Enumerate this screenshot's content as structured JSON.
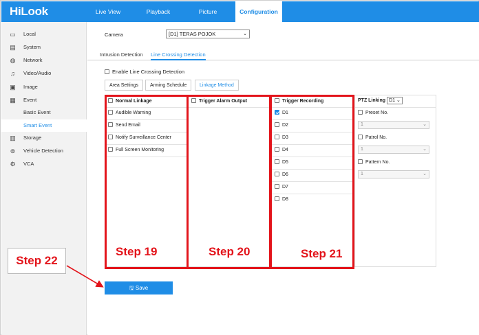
{
  "brand": {
    "logo": "HiLook"
  },
  "topnav": [
    {
      "label": "Live View"
    },
    {
      "label": "Playback"
    },
    {
      "label": "Picture"
    },
    {
      "label": "Configuration",
      "active": true
    }
  ],
  "sidebar": {
    "items": [
      {
        "label": "Local",
        "icon": "monitor-icon"
      },
      {
        "label": "System",
        "icon": "system-icon"
      },
      {
        "label": "Network",
        "icon": "globe-icon"
      },
      {
        "label": "Video/Audio",
        "icon": "video-audio-icon"
      },
      {
        "label": "Image",
        "icon": "image-icon"
      },
      {
        "label": "Event",
        "icon": "event-icon"
      },
      {
        "label": "Basic Event"
      },
      {
        "label": "Smart Event",
        "active": true
      },
      {
        "label": "Storage",
        "icon": "storage-icon"
      },
      {
        "label": "Vehicle Detection",
        "icon": "vehicle-icon"
      },
      {
        "label": "VCA",
        "icon": "vca-icon"
      }
    ]
  },
  "camera": {
    "label": "Camera",
    "value": "[D1] TERAS POJOK"
  },
  "tabs": [
    {
      "label": "Intrusion Detection"
    },
    {
      "label": "Line Crossing Detection",
      "active": true
    }
  ],
  "enable_label": "Enable Line Crossing Detection",
  "subtabs": [
    {
      "label": "Area Settings"
    },
    {
      "label": "Arming Schedule"
    },
    {
      "label": "Linkage Method",
      "active": true
    }
  ],
  "linkage": {
    "normal": {
      "header": "Normal Linkage",
      "items": [
        "Audible Warning",
        "Send Email",
        "Notify Surveillance Center",
        "Full Screen Monitoring"
      ]
    },
    "alarm_output": {
      "header": "Trigger Alarm Output"
    },
    "recording": {
      "header": "Trigger Recording",
      "items": [
        {
          "label": "D1",
          "checked": true
        },
        {
          "label": "D2",
          "checked": false
        },
        {
          "label": "D3",
          "checked": false
        },
        {
          "label": "D4",
          "checked": false
        },
        {
          "label": "D5",
          "checked": false
        },
        {
          "label": "D6",
          "checked": false
        },
        {
          "label": "D7",
          "checked": false
        },
        {
          "label": "D8",
          "checked": false
        }
      ]
    },
    "ptz": {
      "header": "PTZ Linking",
      "channel": "D1",
      "preset_label": "Preset No.",
      "preset_value": "1",
      "patrol_label": "Patrol No.",
      "patrol_value": "1",
      "pattern_label": "Pattern No.",
      "pattern_value": "1"
    }
  },
  "annotations": {
    "step19": "Step 19",
    "step20": "Step 20",
    "step21": "Step 21",
    "step22": "Step 22",
    "color": "#e3141b"
  },
  "save_label": "Save",
  "colors": {
    "accent": "#1f8de6",
    "annotation": "#e3141b"
  }
}
